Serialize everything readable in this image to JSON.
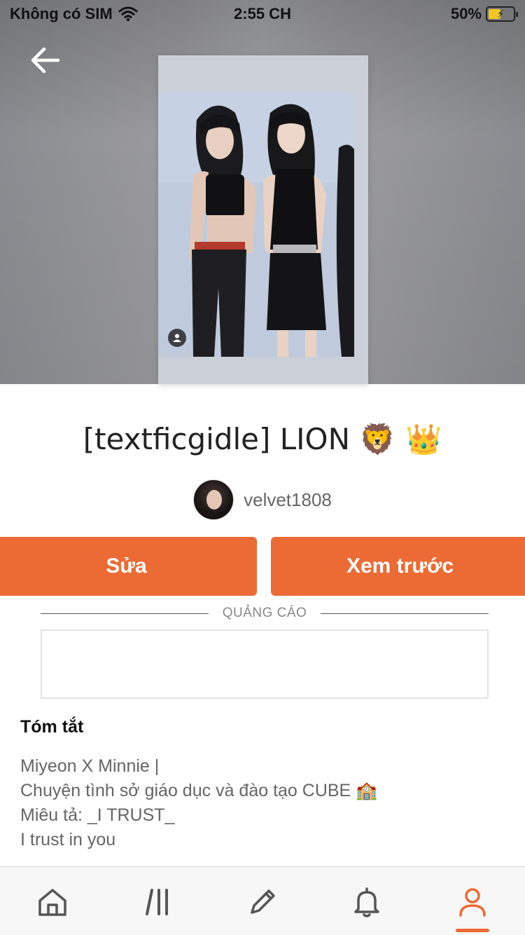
{
  "status_bar": {
    "carrier": "Không có SIM",
    "time": "2:55 CH",
    "battery_percent": "50%",
    "battery_level": 0.5,
    "icons": [
      "wifi-icon",
      "battery-charging-icon"
    ]
  },
  "header": {
    "back_icon": "arrow-left-icon"
  },
  "cover": {
    "icon": "user-icon"
  },
  "story": {
    "title": "[textficgidle] LION 🦁 👑",
    "author": "velvet1808"
  },
  "actions": {
    "edit_label": "Sửa",
    "preview_label": "Xem trước"
  },
  "ad": {
    "label": "QUẢNG CÁO"
  },
  "summary": {
    "heading": "Tóm tắt",
    "lines": [
      "Miyeon X Minnie |",
      "Chuyện tình sở giáo dục và đào tạo CUBE 🏫",
      "Miêu tả: _I TRUST_",
      "I trust in you"
    ]
  },
  "bottom_nav": {
    "items": [
      {
        "icon": "home-icon",
        "active": false
      },
      {
        "icon": "library-icon",
        "active": false
      },
      {
        "icon": "write-icon",
        "active": false
      },
      {
        "icon": "bell-icon",
        "active": false
      },
      {
        "icon": "profile-icon",
        "active": true
      }
    ]
  },
  "colors": {
    "accent": "#ec6b35",
    "text_muted": "#666666"
  }
}
